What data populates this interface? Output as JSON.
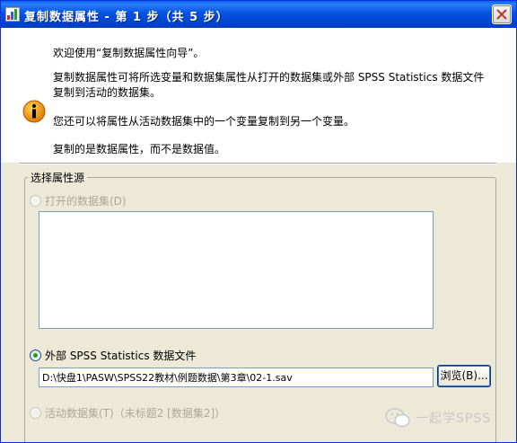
{
  "window": {
    "title": "复制数据属性 - 第 1 步（共 5 步）",
    "close_icon": "close-icon",
    "title_icon": "spss-app-icon"
  },
  "info": {
    "icon": "info-icon",
    "lines": [
      "欢迎使用“复制数据属性向导”。",
      "复制数据属性可将所选变量和数据集属性从打开的数据集或外部 SPSS Statistics 数据文件",
      "复制到活动的数据集。",
      "您还可以将属性从活动数据集中的一个变量复制到另一个变量。",
      "复制的是数据属性，而不是数据值。"
    ]
  },
  "source_group": {
    "legend": "选择属性源",
    "open_dataset": {
      "label": "打开的数据集(D)",
      "selected": false,
      "enabled": false
    },
    "external_file": {
      "label": "外部 SPSS Statistics 数据文件",
      "selected": true,
      "enabled": true
    },
    "path_value": "D:\\快盘1\\PASW\\SPSS22教材\\例题数据\\第3章\\02-1.sav",
    "browse_label": "浏览(B)...",
    "active_dataset": {
      "label": "活动数据集(T)（未标题2 [数据集2]）",
      "selected": false,
      "enabled": false
    }
  },
  "watermark": {
    "text": "一起学SPSS",
    "icon": "wechat-icon"
  },
  "colors": {
    "titlebar": "#0054e3",
    "panel": "#ece9d8",
    "selected_radio": "#21a121"
  }
}
